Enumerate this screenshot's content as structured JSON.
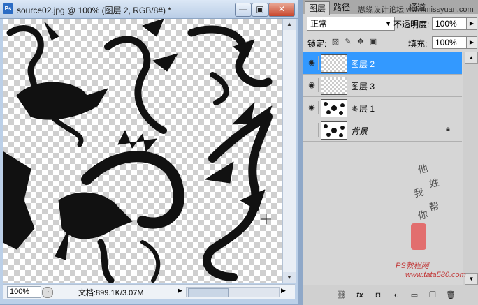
{
  "window": {
    "app_badge": "Ps",
    "title": "source02.jpg @ 100% (图层 2, RGB/8#) *",
    "minimize": "—",
    "restore": "▣",
    "close": "✕"
  },
  "status": {
    "zoom": "100%",
    "doc_info": "文档:899.1K/3.07M"
  },
  "panel": {
    "tabs": [
      "图层",
      "路径",
      "通道"
    ],
    "top_watermark": "思缘设计论坛 www.missyuan.com",
    "blend_mode": "正常",
    "opacity_label": "不透明度:",
    "opacity": "100%",
    "lock_label": "锁定:",
    "fill_label": "填充:",
    "fill": "100%",
    "layers": [
      {
        "name": "图层 2",
        "visible": true,
        "selected": true,
        "thumb": "transparent"
      },
      {
        "name": "图层 3",
        "visible": false,
        "selected": false,
        "thumb": "transparent"
      },
      {
        "name": "图层 1",
        "visible": true,
        "selected": false,
        "thumb": "dragons"
      },
      {
        "name": "背景",
        "visible": false,
        "selected": false,
        "thumb": "dragons",
        "locked": true
      }
    ],
    "signature": [
      "他",
      "姓",
      "我",
      "帮",
      "你"
    ],
    "bottom_watermark": "PS教程网",
    "bottom_url": "www.tata580.com"
  },
  "colors": {
    "selection": "#3399ff",
    "panel_bg": "#d6d6d6",
    "window_chrome": "#bcd0e8"
  }
}
